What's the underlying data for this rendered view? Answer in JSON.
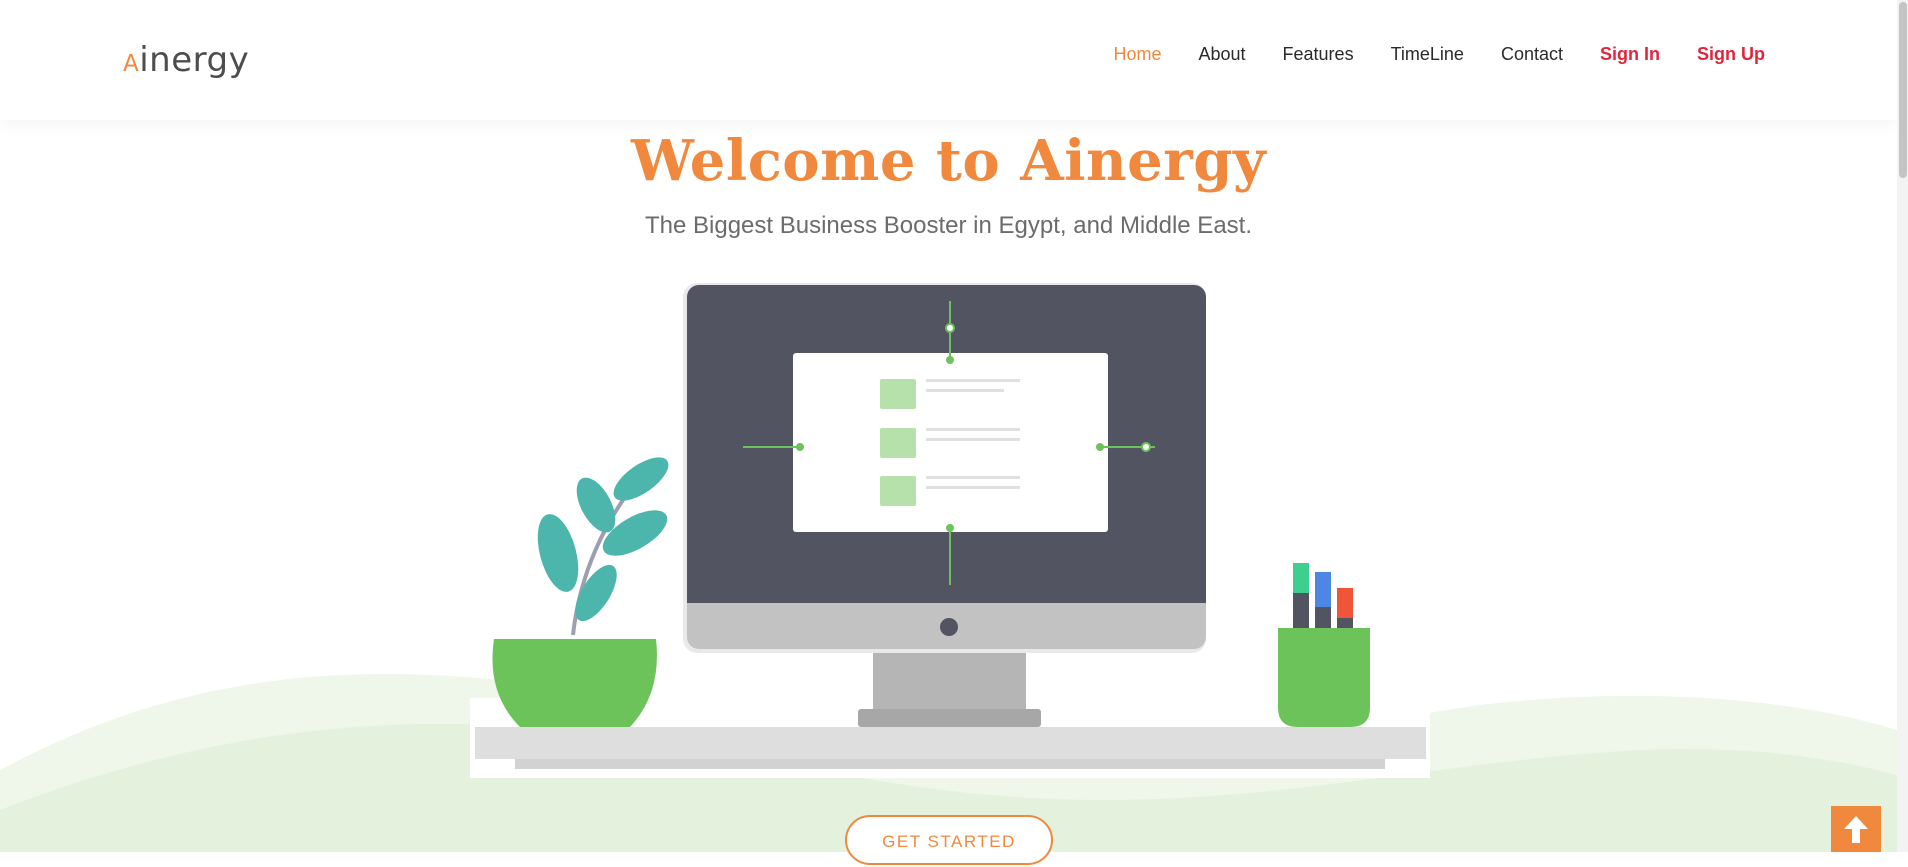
{
  "header": {
    "logo": {
      "initial": "A",
      "rest": "inergy"
    },
    "nav": [
      {
        "label": "Home",
        "active": true
      },
      {
        "label": "About"
      },
      {
        "label": "Features"
      },
      {
        "label": "TimeLine"
      },
      {
        "label": "Contact"
      },
      {
        "label": "Sign In",
        "emphasis": true
      },
      {
        "label": "Sign Up",
        "emphasis": true
      }
    ]
  },
  "hero": {
    "title": "Welcome to Ainergy",
    "subtitle": "The Biggest Business Booster in Egypt, and Middle East.",
    "cta_label": "GET STARTED"
  },
  "icons": {
    "back_to_top": "arrow-up-icon"
  },
  "colors": {
    "accent": "#f0883e",
    "auth_links": "#e0263d",
    "plant_green": "#6cc35a",
    "leaf_teal": "#4db6ac",
    "hill_green": "#e8f4e3"
  }
}
